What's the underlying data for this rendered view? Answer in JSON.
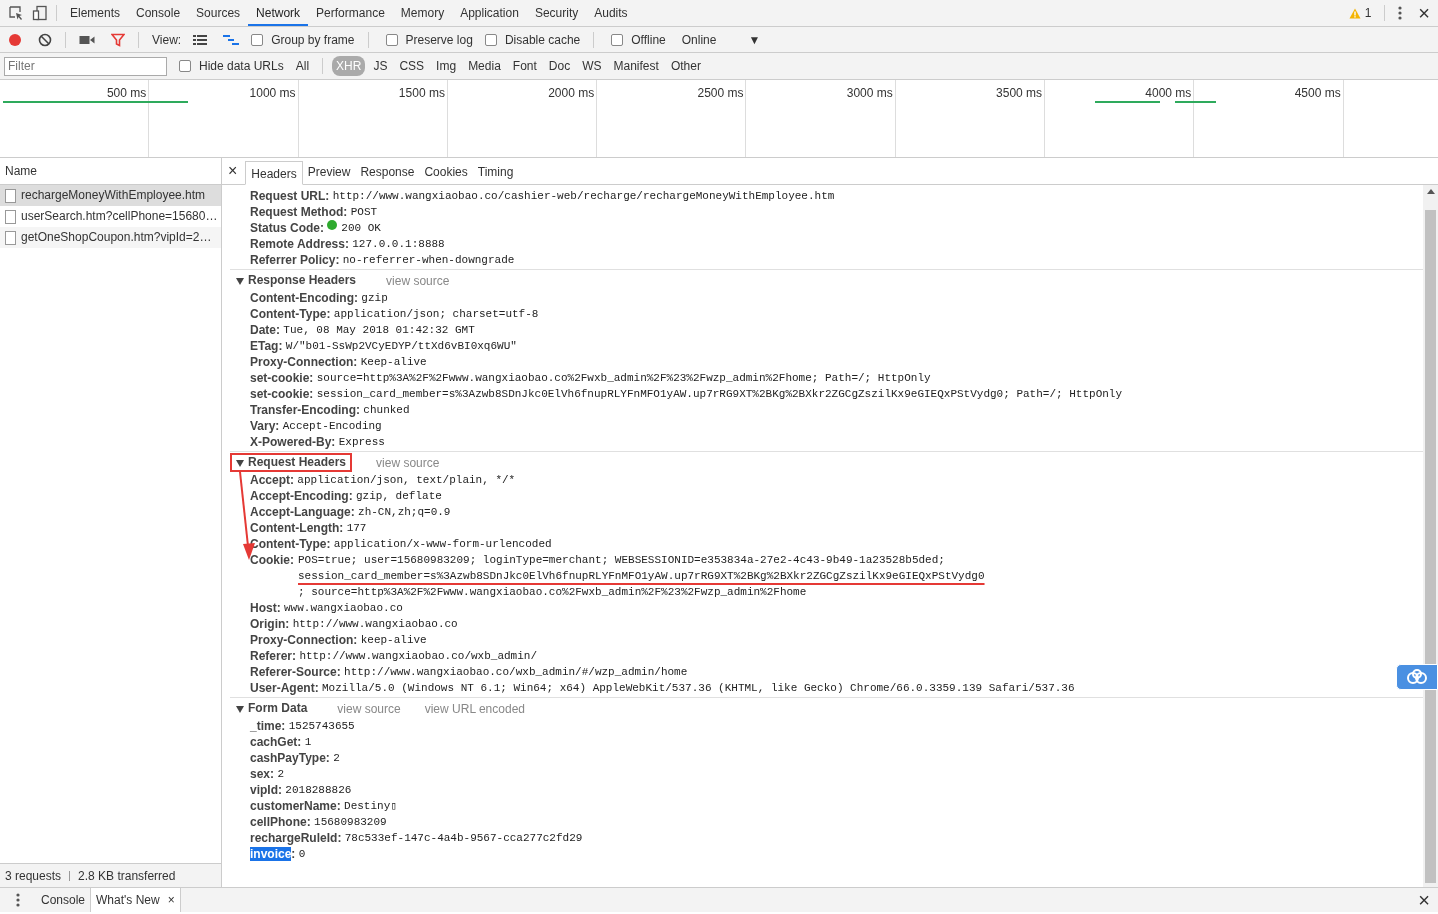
{
  "top_tabs": [
    {
      "label": "Elements",
      "selected": false
    },
    {
      "label": "Console",
      "selected": false
    },
    {
      "label": "Sources",
      "selected": false
    },
    {
      "label": "Network",
      "selected": true
    },
    {
      "label": "Performance",
      "selected": false
    },
    {
      "label": "Memory",
      "selected": false
    },
    {
      "label": "Application",
      "selected": false
    },
    {
      "label": "Security",
      "selected": false
    },
    {
      "label": "Audits",
      "selected": false
    }
  ],
  "warning_count": "1",
  "close": "×",
  "toolbar": {
    "recording": true,
    "filter_active": true,
    "view_label": "View:",
    "checkboxes": [
      {
        "label": "Group by frame",
        "checked": false
      },
      {
        "label": "Preserve log",
        "checked": false
      },
      {
        "label": "Disable cache",
        "checked": false
      },
      {
        "label": "Offline",
        "checked": false
      }
    ],
    "throttle": "Online",
    "throttle_caret": "▼"
  },
  "filter_bar": {
    "placeholder": "Filter",
    "hide_data_urls": {
      "label": "Hide data URLs",
      "checked": false
    },
    "types": [
      {
        "label": "All",
        "selected": false
      },
      {
        "label": "XHR",
        "selected": true
      },
      {
        "label": "JS",
        "selected": false
      },
      {
        "label": "CSS",
        "selected": false
      },
      {
        "label": "Img",
        "selected": false
      },
      {
        "label": "Media",
        "selected": false
      },
      {
        "label": "Font",
        "selected": false
      },
      {
        "label": "Doc",
        "selected": false
      },
      {
        "label": "WS",
        "selected": false
      },
      {
        "label": "Manifest",
        "selected": false
      },
      {
        "label": "Other",
        "selected": false
      }
    ]
  },
  "timeline": {
    "ticks": [
      "500 ms",
      "1000 ms",
      "1500 ms",
      "2000 ms",
      "2500 ms",
      "3000 ms",
      "3500 ms",
      "4000 ms",
      "4500 ms"
    ]
  },
  "requests": {
    "header": "Name",
    "items": [
      {
        "name": "rechargeMoneyWithEmployee.htm",
        "selected": true
      },
      {
        "name": "userSearch.htm?cellPhone=15680…",
        "selected": false
      },
      {
        "name": "getOneShopCoupon.htm?vipId=2…",
        "selected": false
      }
    ],
    "summary": [
      "3 requests",
      "2.8 KB transferred"
    ]
  },
  "detail": {
    "close": "×",
    "tabs": [
      {
        "label": "Headers",
        "selected": true
      },
      {
        "label": "Preview",
        "selected": false
      },
      {
        "label": "Response",
        "selected": false
      },
      {
        "label": "Cookies",
        "selected": false
      },
      {
        "label": "Timing",
        "selected": false
      }
    ],
    "general": [
      {
        "kind": "text",
        "key": "Request URL:",
        "value": "http://www.wangxiaobao.co/cashier-web/recharge/rechargeMoneyWithEmployee.htm"
      },
      {
        "kind": "text",
        "key": "Request Method:",
        "value": "POST"
      },
      {
        "kind": "status",
        "key": "Status Code:",
        "value": "200 OK"
      },
      {
        "kind": "text",
        "key": "Remote Address:",
        "value": "127.0.0.1:8888"
      },
      {
        "kind": "text",
        "key": "Referrer Policy:",
        "value": "no-referrer-when-downgrade"
      }
    ],
    "sections": [
      {
        "title": "Response Headers",
        "expanded": true,
        "highlighted": false,
        "links": [
          "view source"
        ],
        "rows": [
          {
            "key": "Content-Encoding:",
            "value": "gzip"
          },
          {
            "key": "Content-Type:",
            "value": "application/json; charset=utf-8"
          },
          {
            "key": "Date:",
            "value": "Tue, 08 May 2018 01:42:32 GMT"
          },
          {
            "key": "ETag:",
            "value": "W/\"b01-SsWp2VCyEDYP/ttXd6vBI0xq6WU\""
          },
          {
            "key": "Proxy-Connection:",
            "value": "Keep-alive"
          },
          {
            "key": "set-cookie:",
            "value": "source=http%3A%2F%2Fwww.wangxiaobao.co%2Fwxb_admin%2F%23%2Fwzp_admin%2Fhome; Path=/; HttpOnly"
          },
          {
            "key": "set-cookie:",
            "value": "session_card_member=s%3Azwb8SDnJkc0ElVh6fnupRLYFnMFO1yAW.up7rRG9XT%2BKg%2BXkr2ZGCgZszilKx9eGIEQxPStVydg0; Path=/; HttpOnly"
          },
          {
            "key": "Transfer-Encoding:",
            "value": "chunked"
          },
          {
            "key": "Vary:",
            "value": "Accept-Encoding"
          },
          {
            "key": "X-Powered-By:",
            "value": "Express"
          }
        ]
      },
      {
        "title": "Request Headers",
        "expanded": true,
        "highlighted": true,
        "links": [
          "view source"
        ],
        "rows": [
          {
            "key": "Accept:",
            "value": "application/json, text/plain, */*"
          },
          {
            "key": "Accept-Encoding:",
            "value": "gzip, deflate"
          },
          {
            "key": "Accept-Language:",
            "value": "zh-CN,zh;q=0.9"
          },
          {
            "key": "Content-Length:",
            "value": "177"
          },
          {
            "key": "Content-Type:",
            "value": "application/x-www-form-urlencoded"
          },
          {
            "key": "Cookie:",
            "segments": [
              {
                "text": "POS=true; user=15680983209; loginType=merchant; WEBSESSIONID=e353834a-27e2-4c43-9b49-1a23528b5ded; ",
                "underline": false
              },
              {
                "text": "session_card_member=s%3Azwb8SDnJkc0ElVh6fnupRLYFnMFO1yAW.up7rRG9XT%2BKg%2BXkr2ZGCgZszilKx9eGIEQxPStVydg0",
                "underline": true
              },
              {
                "text": "; source=http%3A%2F%2Fwww.wangxiaobao.co%2Fwxb_admin%2F%23%2Fwzp_admin%2Fhome",
                "underline": false
              }
            ]
          },
          {
            "key": "Host:",
            "value": "www.wangxiaobao.co"
          },
          {
            "key": "Origin:",
            "value": "http://www.wangxiaobao.co"
          },
          {
            "key": "Proxy-Connection:",
            "value": "keep-alive"
          },
          {
            "key": "Referer:",
            "value": "http://www.wangxiaobao.co/wxb_admin/"
          },
          {
            "key": "Referer-Source:",
            "value": "http://www.wangxiaobao.co/wxb_admin/#/wzp_admin/home"
          },
          {
            "key": "User-Agent:",
            "value": "Mozilla/5.0 (Windows NT 6.1; Win64; x64) AppleWebKit/537.36 (KHTML, like Gecko) Chrome/66.0.3359.139 Safari/537.36"
          }
        ]
      },
      {
        "title": "Form Data",
        "expanded": true,
        "highlighted": false,
        "colon": ":",
        "links": [
          "view source",
          "view URL encoded"
        ],
        "rows": [
          {
            "key": "_time",
            "value": "1525743655",
            "key_selected": false
          },
          {
            "key": "cachGet",
            "value": "1",
            "key_selected": false
          },
          {
            "key": "cashPayType",
            "value": "2",
            "key_selected": false
          },
          {
            "key": "sex",
            "value": "2",
            "key_selected": false
          },
          {
            "key": "vipId",
            "value": "2018288826",
            "key_selected": false
          },
          {
            "key": "customerName",
            "value": "Destiny▯",
            "key_selected": false
          },
          {
            "key": "cellPhone",
            "value": "15680983209",
            "key_selected": false
          },
          {
            "key": "rechargeRuleId",
            "value": "78c533ef-147c-4a4b-9567-cca277c2fd29",
            "key_selected": false
          },
          {
            "key": "invoice",
            "value": "0",
            "key_selected": true
          }
        ]
      }
    ]
  },
  "drawer": {
    "tabs": [
      {
        "label": "Console",
        "selected": false,
        "closable": false
      },
      {
        "label": "What's New",
        "selected": true,
        "closable": true
      }
    ],
    "tab_close": "×",
    "close": "×"
  }
}
